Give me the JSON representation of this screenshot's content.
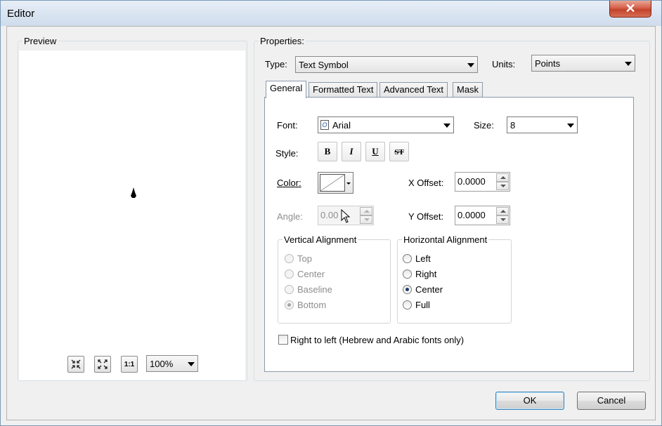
{
  "window": {
    "title": "Editor",
    "close_glyph": "✕"
  },
  "preview": {
    "label": "Preview",
    "zoom_value": "100%",
    "tools": [
      {
        "name": "zoom-in-fixed-icon",
        "glyph": "⤡"
      },
      {
        "name": "full-extent-icon",
        "glyph": "⛶"
      },
      {
        "name": "one-to-one-icon",
        "glyph": "1:1"
      }
    ]
  },
  "properties": {
    "label": "Properties:",
    "type_label": "Type:",
    "type_value": "Text Symbol",
    "units_label": "Units:",
    "units_value": "Points"
  },
  "tabs": [
    {
      "label": "General",
      "active": true
    },
    {
      "label": "Formatted Text",
      "active": false
    },
    {
      "label": "Advanced Text",
      "active": false
    },
    {
      "label": "Mask",
      "active": false
    }
  ],
  "general": {
    "font_label": "Font:",
    "font_value": "Arial",
    "size_label": "Size:",
    "size_value": "8",
    "style_label": "Style:",
    "style_buttons": [
      "B",
      "I",
      "U",
      "ST"
    ],
    "color_label": "Color:",
    "x_offset_label": "X Offset:",
    "x_offset_value": "0.0000",
    "angle_label": "Angle:",
    "angle_value": "0.00",
    "y_offset_label": "Y Offset:",
    "y_offset_value": "0.0000",
    "vertical_alignment": {
      "label": "Vertical Alignment",
      "options": [
        "Top",
        "Center",
        "Baseline",
        "Bottom"
      ],
      "selected": "Bottom",
      "enabled": false
    },
    "horizontal_alignment": {
      "label": "Horizontal Alignment",
      "options": [
        "Left",
        "Right",
        "Center",
        "Full"
      ],
      "selected": "Center",
      "enabled": true
    },
    "rtl_label": "Right to left (Hebrew and Arabic fonts only)"
  },
  "buttons": {
    "ok": "OK",
    "cancel": "Cancel"
  },
  "colors": {
    "accent": "#3c7fb1",
    "close_red": "#c2432c",
    "disabled_text": "#8d8d8d"
  }
}
